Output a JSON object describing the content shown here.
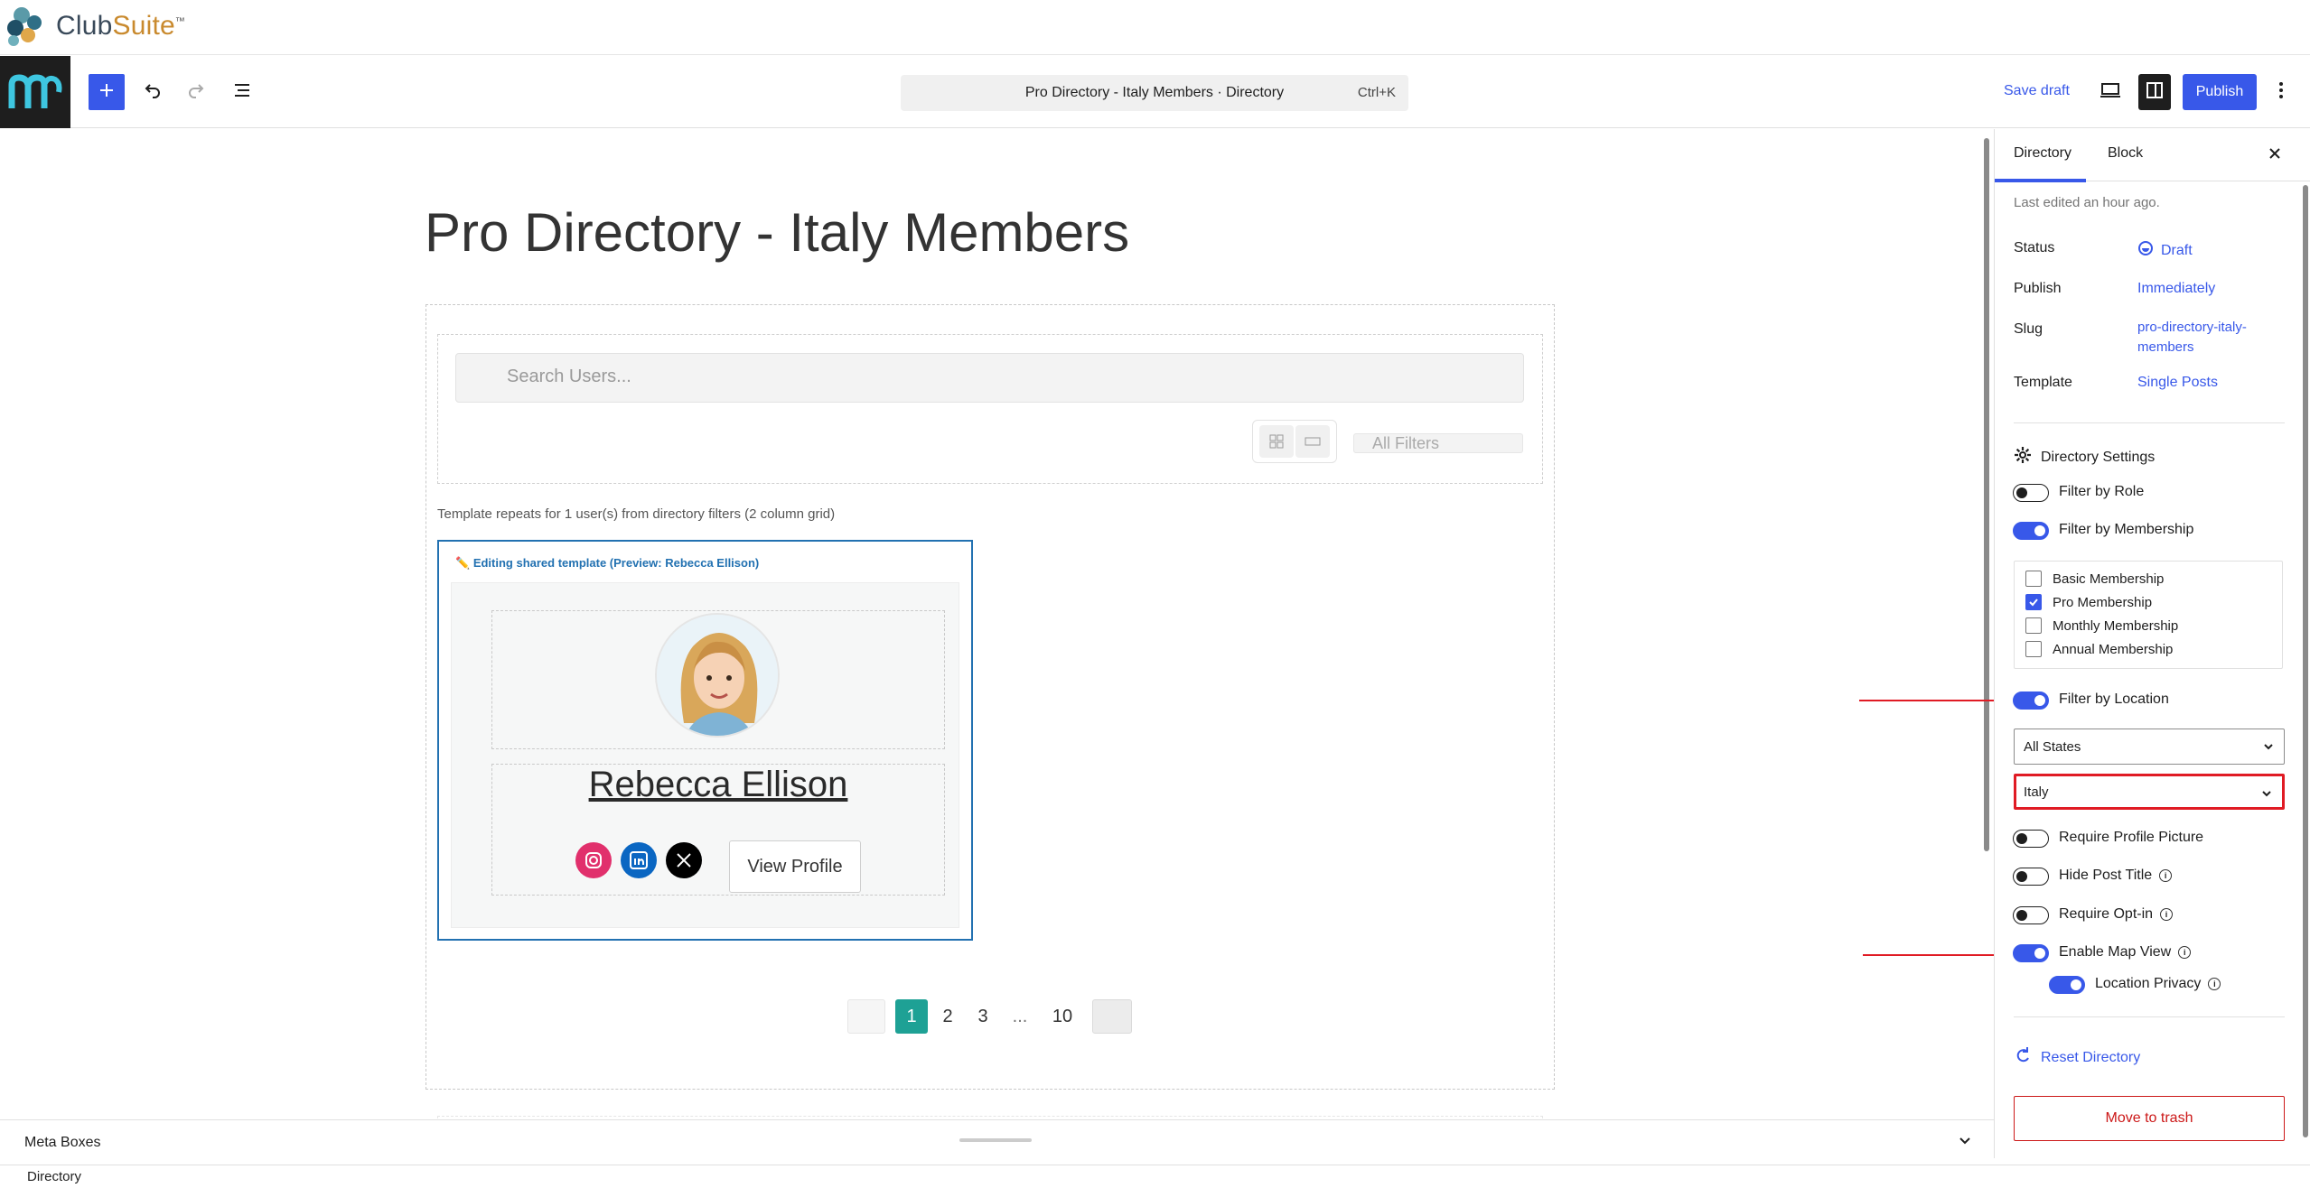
{
  "brand": {
    "name_part1": "Club",
    "name_part2": "Suite",
    "tm": "™"
  },
  "toolbar": {
    "doc_title": "Pro Directory - Italy Members · Directory",
    "shortcut": "Ctrl+K",
    "save_draft": "Save draft",
    "publish": "Publish",
    "icons": [
      "add-icon",
      "undo-icon",
      "redo-icon",
      "list-view-icon",
      "desktop-view-icon",
      "settings-panel-icon",
      "more-options-icon"
    ]
  },
  "canvas": {
    "page_title": "Pro Directory - Italy Members",
    "search_placeholder": "Search Users...",
    "all_filters": "All Filters",
    "repeat_note": "Template repeats for 1 user(s) from directory filters (2 column grid)",
    "card": {
      "tag": "Editing shared template (Preview: Rebecca Ellison)",
      "member_name": "Rebecca Ellison",
      "view_profile": "View Profile",
      "social": [
        "instagram-icon",
        "linkedin-icon",
        "x-icon"
      ]
    },
    "pagination": {
      "pages": [
        "1",
        "2",
        "3",
        "...",
        "10"
      ],
      "current": "1"
    }
  },
  "sidebar": {
    "tabs": {
      "directory": "Directory",
      "block": "Block"
    },
    "last_edited": "Last edited an hour ago.",
    "rows": {
      "status_label": "Status",
      "status_value": "Draft",
      "publish_label": "Publish",
      "publish_value": "Immediately",
      "slug_label": "Slug",
      "slug_value_line1": "pro-directory-italy-",
      "slug_value_line2": "members",
      "template_label": "Template",
      "template_value": "Single Posts"
    },
    "settings_title": "Directory Settings",
    "toggles": {
      "filter_role": {
        "label": "Filter by Role",
        "on": false
      },
      "filter_membership": {
        "label": "Filter by Membership",
        "on": true
      },
      "filter_location": {
        "label": "Filter by Location",
        "on": true
      },
      "require_picture": {
        "label": "Require Profile Picture",
        "on": false
      },
      "hide_title": {
        "label": "Hide Post Title",
        "on": false
      },
      "require_optin": {
        "label": "Require Opt-in",
        "on": false
      },
      "enable_map": {
        "label": "Enable Map View",
        "on": true
      },
      "location_privacy": {
        "label": "Location Privacy",
        "on": true
      }
    },
    "memberships": [
      {
        "label": "Basic Membership",
        "checked": false
      },
      {
        "label": "Pro Membership",
        "checked": true
      },
      {
        "label": "Monthly Membership",
        "checked": false
      },
      {
        "label": "Annual Membership",
        "checked": false
      }
    ],
    "state_select": "All States",
    "country_select": "Italy",
    "reset": "Reset Directory",
    "trash": "Move to trash"
  },
  "meta": {
    "label": "Meta Boxes",
    "breadcrumb": "Directory"
  },
  "colors": {
    "accent": "#3858e9",
    "teal": "#1ea195",
    "highlight_red": "#e01b24",
    "card_border": "#2271b1"
  }
}
